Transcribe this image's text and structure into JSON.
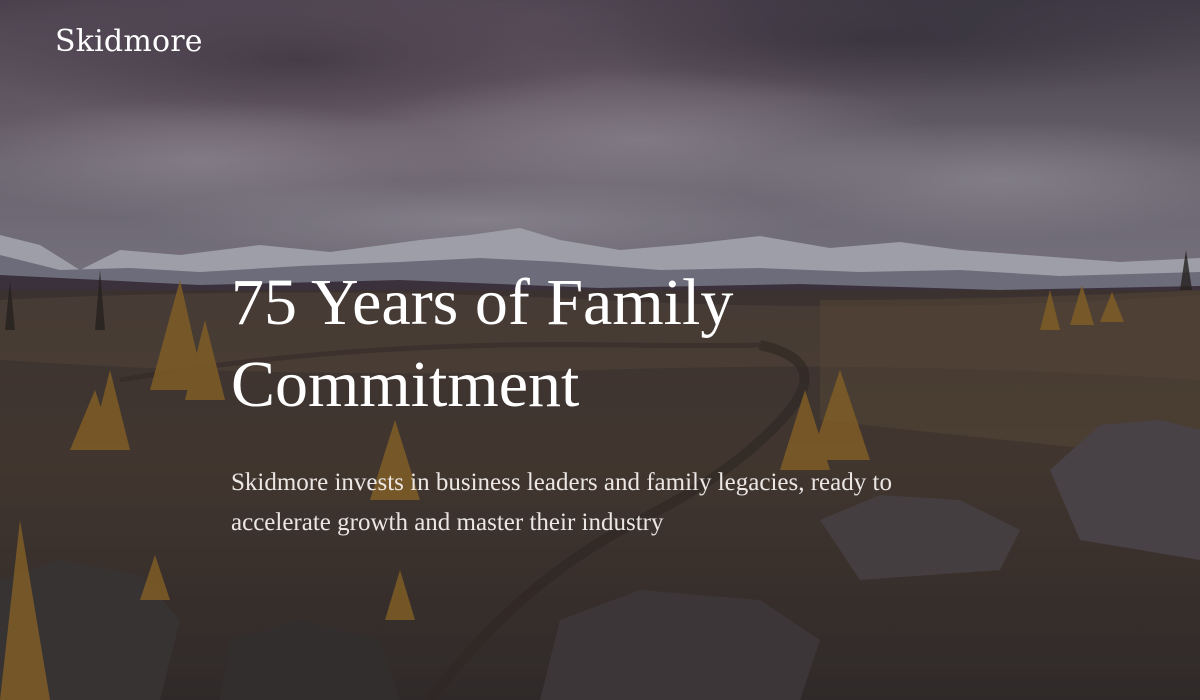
{
  "header": {
    "logo": "Skidmore"
  },
  "hero": {
    "title": "75 Years of Family Commitment",
    "subtitle": "Skidmore invests in business leaders and family legacies, ready to accelerate growth and master their industry"
  },
  "colors": {
    "sky": "#5e5a69",
    "mountain_snow": "#c9cbd6",
    "grass": "#5a4a3a",
    "larch": "#a77a2c",
    "text": "#ffffff"
  }
}
